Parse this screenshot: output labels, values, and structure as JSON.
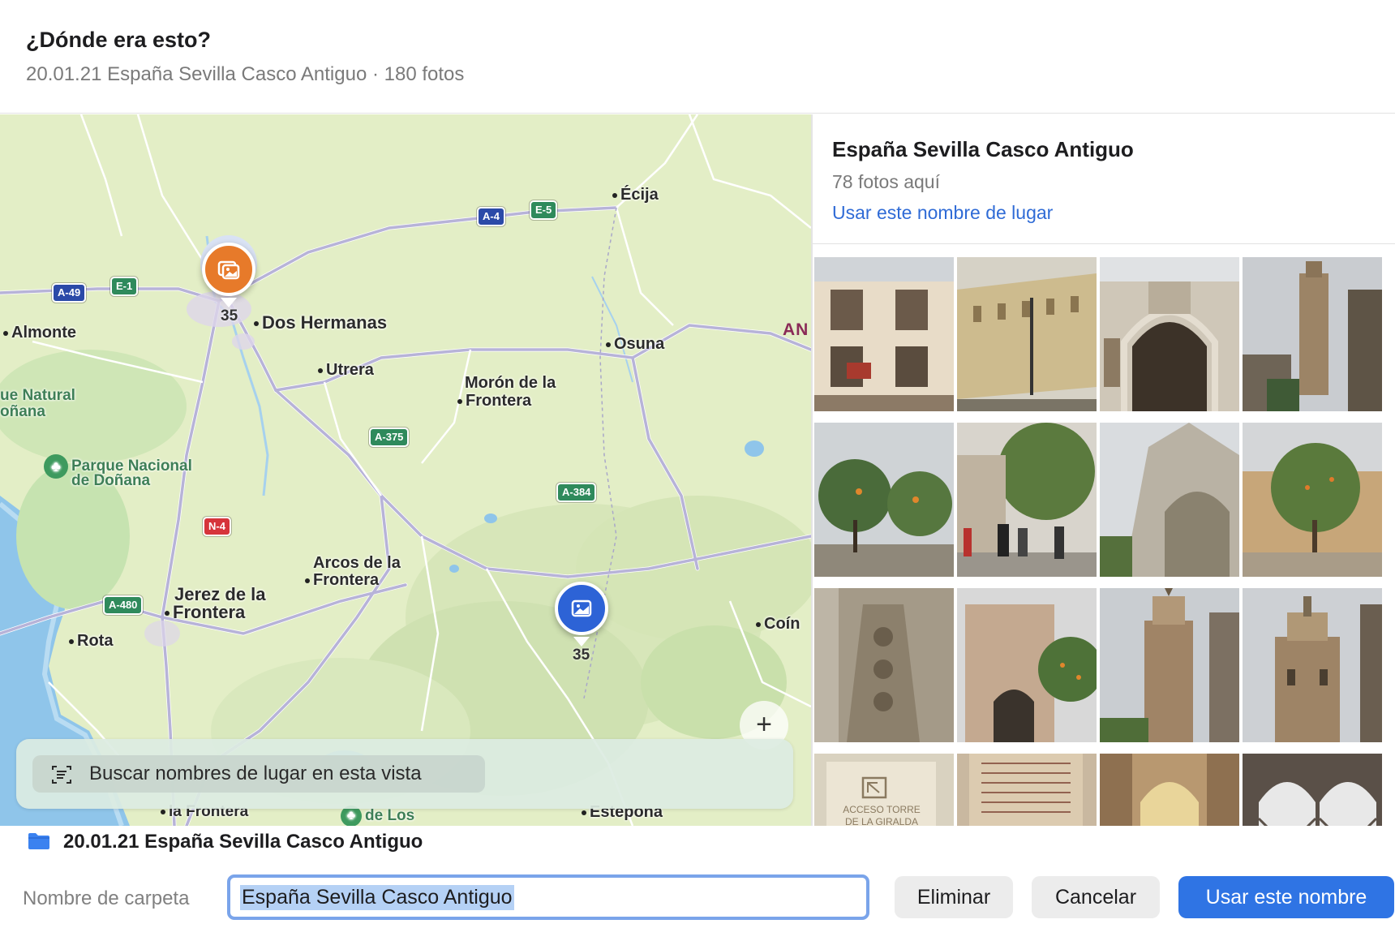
{
  "header": {
    "title": "¿Dónde era esto?",
    "subtitle": "20.01.21 España Sevilla Casco Antiguo · 180 fotos"
  },
  "map": {
    "places": {
      "ecija": "Écija",
      "dos_hermanas": "Dos Hermanas",
      "almonte": "Almonte",
      "utrera": "Utrera",
      "osuna": "Osuna",
      "moron_1": "Morón de la",
      "moron_2": "Frontera",
      "parque_natural_1": "ue Natural",
      "parque_natural_2": "oñana",
      "donana_1": "Parque Nacional",
      "donana_2": "de Doñana",
      "arcos_1": "Arcos de la",
      "arcos_2": "Frontera",
      "jerez_1": "Jerez de la",
      "jerez_2": "Frontera",
      "rota": "Rota",
      "coin": "Coín",
      "bottom_1": "la Frontera",
      "bottom_2": "de Los",
      "estepona": "Estepona",
      "an": "AN"
    },
    "roads": {
      "a4": "A-4",
      "e5": "E-5",
      "a49": "A-49",
      "e1": "E-1",
      "a375": "A-375",
      "a384": "A-384",
      "n4": "N-4",
      "a480": "A-480"
    },
    "pins": {
      "orange_count": "35",
      "blue_count": "35"
    },
    "zoom_in": "+",
    "search_button": "Buscar nombres de lugar en esta vista"
  },
  "panel": {
    "place_title": "España Sevilla Casco Antiguo",
    "place_count": "78 fotos aquí",
    "use_place_link": "Usar este nombre de lugar",
    "sign_text_1": "ACCESO TORRE",
    "sign_text_2": "DE LA GIRALDA"
  },
  "folder": {
    "label": "20.01.21 España Sevilla Casco Antiguo"
  },
  "footer": {
    "field_label": "Nombre de carpeta",
    "input_value": "España Sevilla Casco Antiguo",
    "delete_button": "Eliminar",
    "cancel_button": "Cancelar",
    "primary_button": "Usar este nombre"
  },
  "colors": {
    "accent": "#2f74e4",
    "link": "#2f6bd6",
    "pin_orange": "#e77a2a",
    "pin_blue": "#2d63d6"
  }
}
